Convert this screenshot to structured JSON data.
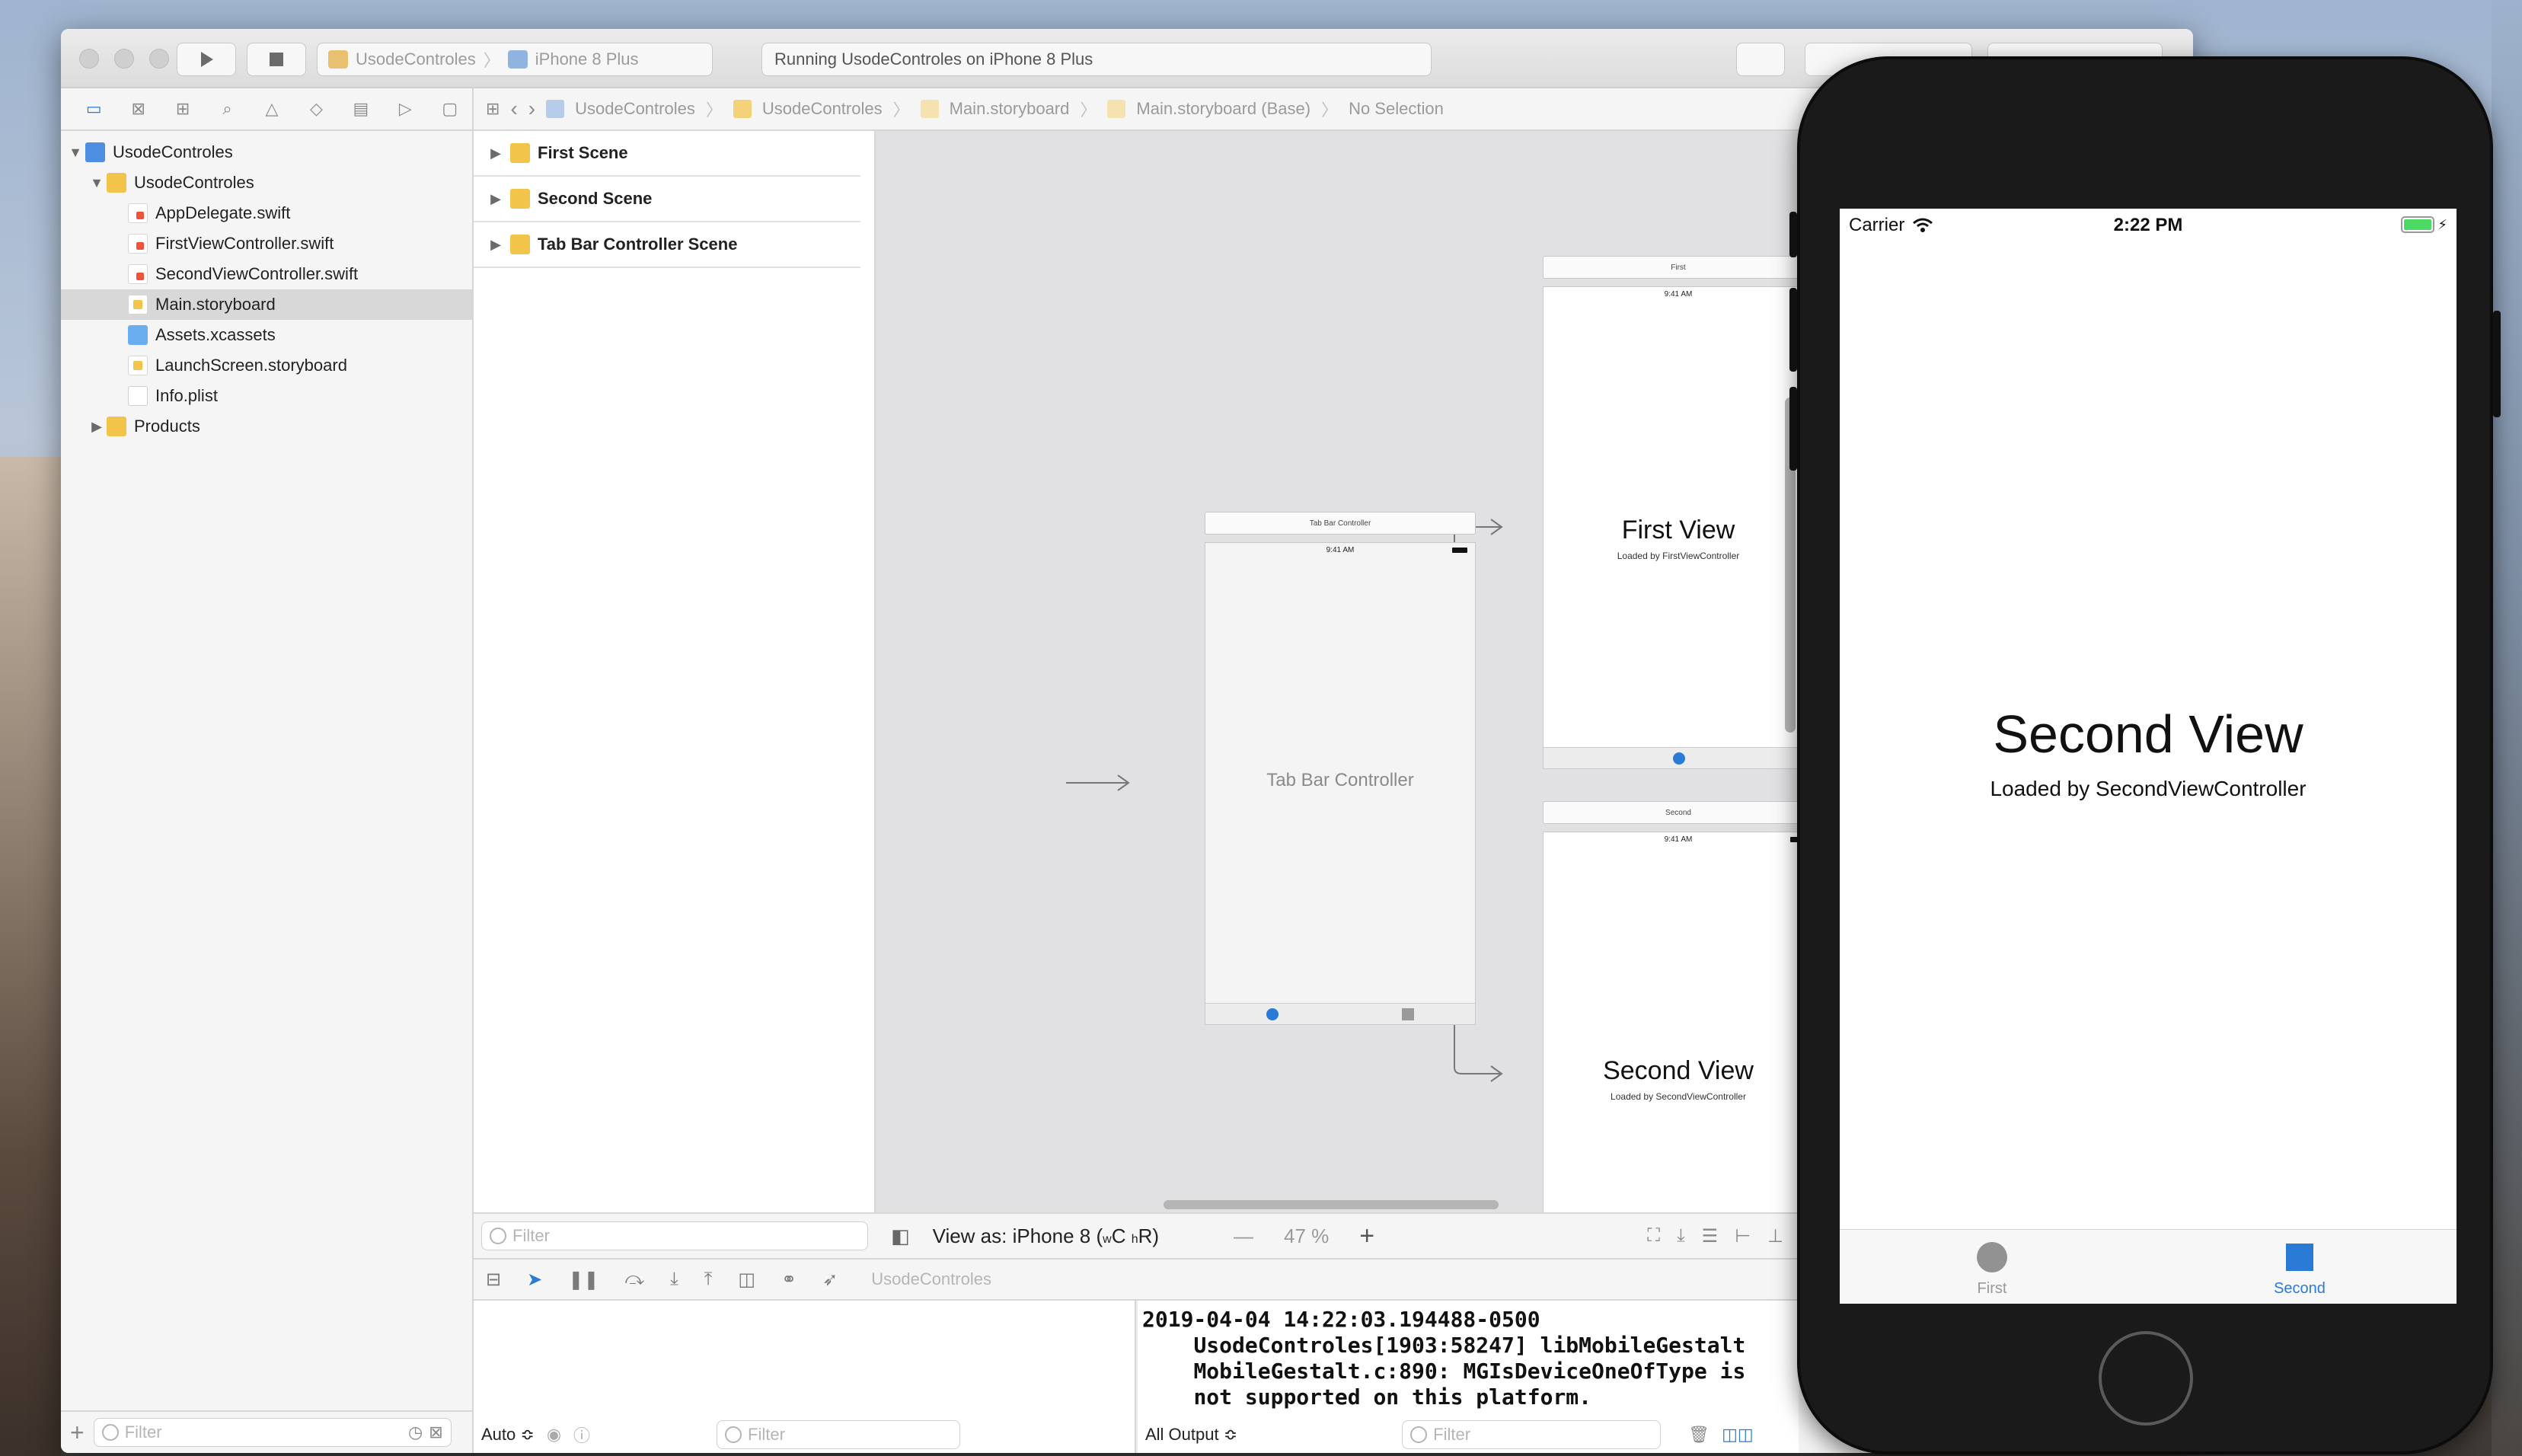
{
  "xcode": {
    "scheme_project": "UsodeControles",
    "scheme_device": "iPhone 8 Plus",
    "activity_text": "Running UsodeControles on iPhone 8 Plus"
  },
  "navigator": {
    "items": [
      {
        "label": "UsodeControles",
        "type": "project"
      },
      {
        "label": "UsodeControles",
        "type": "folder"
      },
      {
        "label": "AppDelegate.swift",
        "type": "swift"
      },
      {
        "label": "FirstViewController.swift",
        "type": "swift"
      },
      {
        "label": "SecondViewController.swift",
        "type": "swift"
      },
      {
        "label": "Main.storyboard",
        "type": "storyboard",
        "selected": true
      },
      {
        "label": "Assets.xcassets",
        "type": "assets"
      },
      {
        "label": "LaunchScreen.storyboard",
        "type": "storyboard"
      },
      {
        "label": "Info.plist",
        "type": "plist"
      },
      {
        "label": "Products",
        "type": "folder"
      }
    ],
    "filter_placeholder": "Filter"
  },
  "jumpbar": {
    "crumbs": [
      "UsodeControles",
      "UsodeControles",
      "Main.storyboard",
      "Main.storyboard (Base)",
      "No Selection"
    ]
  },
  "outline": {
    "scenes": [
      "First Scene",
      "Second Scene",
      "Tab Bar Controller Scene"
    ],
    "filter_placeholder": "Filter"
  },
  "canvas": {
    "tabbar_title": "Tab Bar Controller",
    "tabbar_label": "Tab Bar Controller",
    "status_time": "9:41 AM",
    "first_title": "First",
    "first_view": "First View",
    "first_sub": "Loaded by FirstViewController",
    "second_title": "Second",
    "second_view": "Second View",
    "second_sub": "Loaded by SecondViewController"
  },
  "canvas_bar": {
    "view_as": "View as: iPhone 8 (",
    "view_as_w": "w",
    "view_as_c": "C ",
    "view_as_h": "h",
    "view_as_r": "R)",
    "zoom_out": "—",
    "zoom": "47 %",
    "zoom_in": "+"
  },
  "debug": {
    "crumb": "UsodeControles"
  },
  "vars_bar": {
    "auto": "Auto ≎",
    "filter_placeholder": "Filter"
  },
  "console": {
    "text": "2019-04-04 14:22:03.194488-0500\n    UsodeControles[1903:58247] libMobileGestalt\n    MobileGestalt.c:890: MGIsDeviceOneOfType is\n    not supported on this platform.",
    "output_selector": "All Output ≎",
    "filter_placeholder": "Filter"
  },
  "simulator": {
    "carrier": "Carrier",
    "time": "2:22 PM",
    "title": "Second View",
    "subtitle": "Loaded by SecondViewController",
    "tabs": [
      {
        "label": "First",
        "selected": false
      },
      {
        "label": "Second",
        "selected": true
      }
    ],
    "accent_color": "#2a7bd6"
  }
}
